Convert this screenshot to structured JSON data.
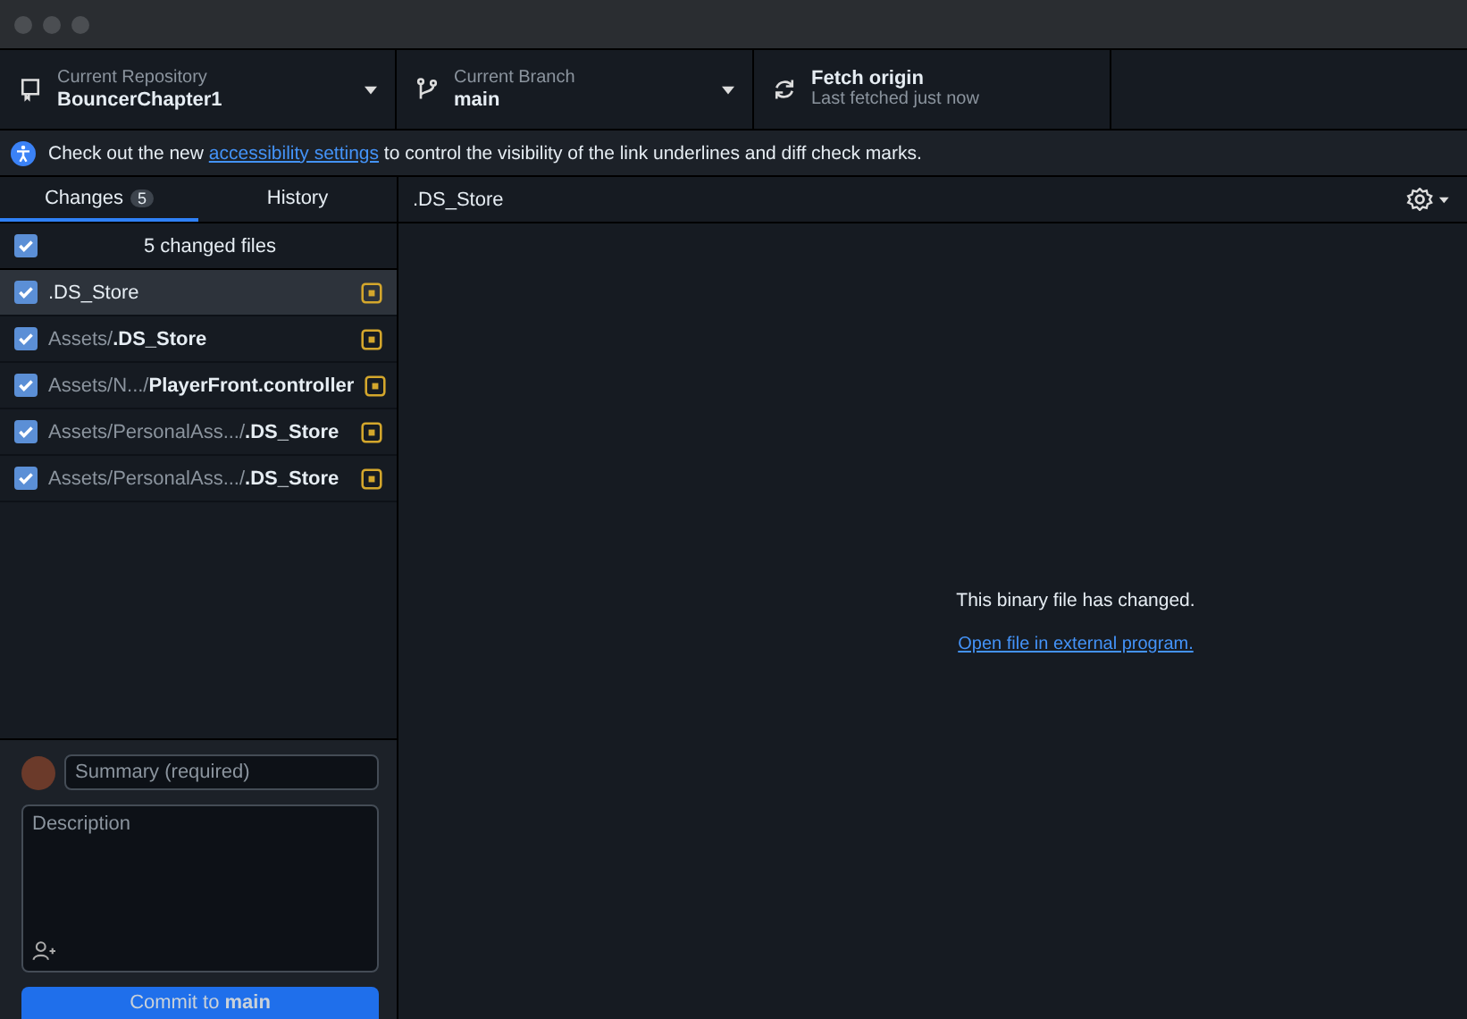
{
  "toolbar": {
    "repository": {
      "label": "Current Repository",
      "value": "BouncerChapter1"
    },
    "branch": {
      "label": "Current Branch",
      "value": "main"
    },
    "fetch": {
      "label": "Fetch origin",
      "sublabel": "Last fetched just now"
    }
  },
  "banner": {
    "before": "Check out the new",
    "link": "accessibility settings",
    "after": "to control the visibility of the link underlines and diff check marks."
  },
  "tabs": [
    {
      "label": "Changes",
      "count": "5",
      "selected": true
    },
    {
      "label": "History",
      "selected": false
    }
  ],
  "changes_header": {
    "label": "5 changed files",
    "checked": true
  },
  "files": [
    {
      "path": ".DS_Store",
      "checked": true,
      "selected": true
    },
    {
      "path": "Assets/**.DS_Store**",
      "checked": true,
      "selected": false
    },
    {
      "path": "Assets/N.../**PlayerFront.controller**",
      "checked": true,
      "selected": false
    },
    {
      "path": "Assets/PersonalAss.../**.DS_Store**",
      "checked": true,
      "selected": false
    },
    {
      "path": "Assets/PersonalAss.../**.DS_Store**",
      "checked": true,
      "selected": false
    }
  ],
  "commit": {
    "summary_placeholder": "Summary (required)",
    "description_placeholder": "Description",
    "button": "Commit to **main**"
  },
  "diff": {
    "filename": ".DS_Store",
    "message": "This binary file has changed.",
    "link": "Open file in external program."
  }
}
